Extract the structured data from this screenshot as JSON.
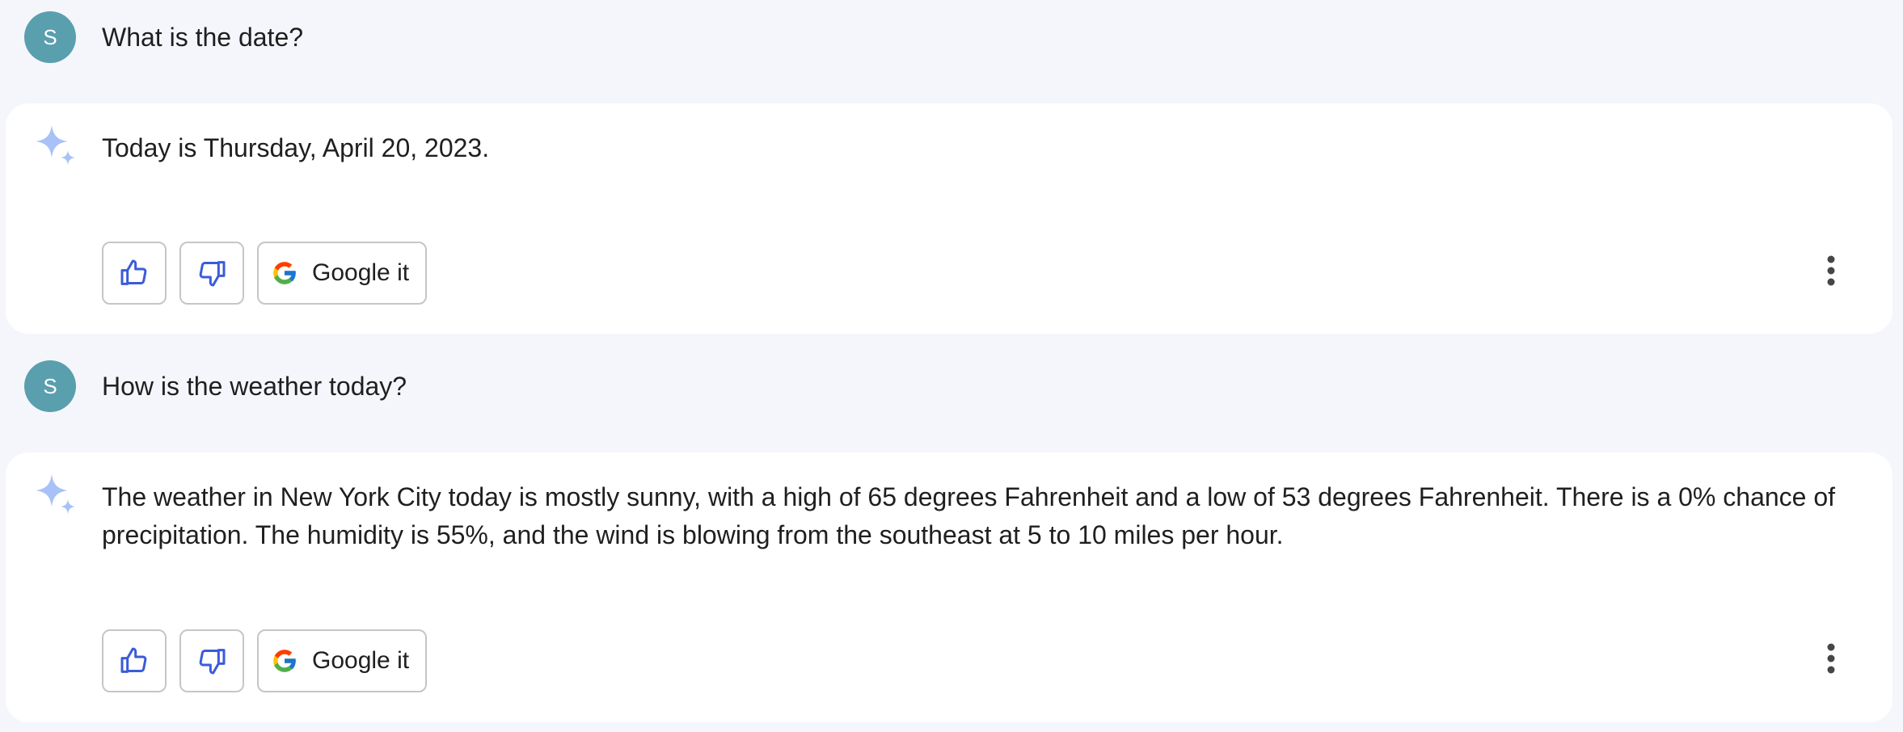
{
  "conversation": [
    {
      "user": {
        "avatar_letter": "S",
        "text": "What is the date?"
      },
      "bot": {
        "text": "Today is Thursday, April 20, 2023.",
        "google_label": "Google it"
      }
    },
    {
      "user": {
        "avatar_letter": "S",
        "text": "How is the weather today?"
      },
      "bot": {
        "text": "The weather in New York City today is mostly sunny, with a high of 65 degrees Fahrenheit and a low of 53 degrees Fahrenheit. There is a 0% chance of precipitation. The humidity is 55%, and the wind is blowing from the southeast at 5 to 10 miles per hour.",
        "google_label": "Google it"
      }
    }
  ],
  "icons": {
    "sparkle": "sparkle-icon",
    "thumbs_up": "thumbs-up-icon",
    "thumbs_down": "thumbs-down-icon",
    "google": "google-logo-icon",
    "more": "more-vertical-icon"
  },
  "colors": {
    "background": "#f5f6fb",
    "card": "#ffffff",
    "avatar": "#5a9fae",
    "icon_blue": "#3b5bdb",
    "sparkle": "#a8c2f7",
    "border": "#c4c7c5"
  }
}
